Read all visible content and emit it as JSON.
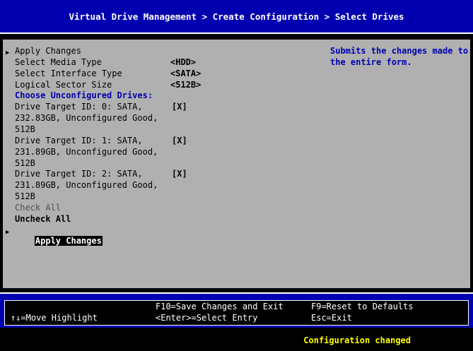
{
  "header": {
    "title": "Virtual Drive Management > Create Configuration > Select Drives"
  },
  "form": {
    "apply_top": "Apply Changes",
    "media_type_label": "Select Media Type",
    "media_type_value": "<HDD>",
    "interface_type_label": "Select Interface Type",
    "interface_type_value": "<SATA>",
    "sector_size_label": "Logical Sector Size",
    "sector_size_value": "<512B>",
    "section_heading": "Choose Unconfigured Drives:",
    "drives": [
      {
        "line1": "Drive Target ID: 0: SATA,",
        "line2": "232.83GB, Unconfigured Good,",
        "line3": "512B",
        "checkbox": "[X]"
      },
      {
        "line1": "Drive Target ID: 1: SATA,",
        "line2": "231.89GB, Unconfigured Good,",
        "line3": "512B",
        "checkbox": "[X]"
      },
      {
        "line1": "Drive Target ID: 2: SATA,",
        "line2": "231.89GB, Unconfigured Good,",
        "line3": "512B",
        "checkbox": "[X]"
      }
    ],
    "check_all": "Check All",
    "uncheck_all": "Uncheck All",
    "apply_bottom": "Apply Changes"
  },
  "help": {
    "line1": "Submits the changes made to",
    "line2": "the entire form."
  },
  "footer": {
    "move_highlight": "↑↓=Move Highlight",
    "save_exit": "F10=Save Changes and Exit",
    "select_entry": "<Enter>=Select Entry",
    "reset_defaults": "F9=Reset to Defaults",
    "esc_exit": "Esc=Exit"
  },
  "status": "Configuration changed",
  "colors": {
    "bios_blue": "#0000b0",
    "panel_gray": "#b0b0b0",
    "status_yellow": "#ffff00"
  }
}
